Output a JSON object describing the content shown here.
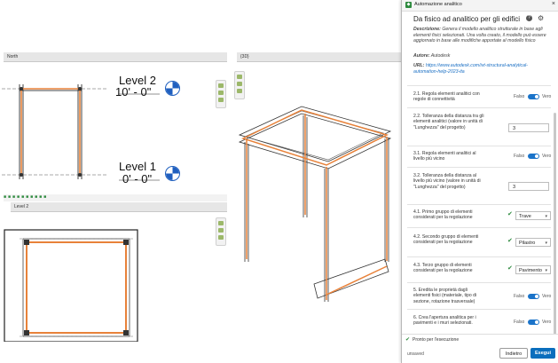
{
  "views": {
    "north": {
      "tab_label": "North",
      "close": "x"
    },
    "view3d": {
      "tab_label": "{3D}",
      "close": "x"
    },
    "level2": {
      "tab_label": "Level 2",
      "close": "x"
    }
  },
  "levels": [
    {
      "name": "Level 2",
      "elevation": "10' - 0\""
    },
    {
      "name": "Level 1",
      "elevation": "0' - 0\""
    }
  ],
  "panel": {
    "window_title": "Automazione analitico",
    "close": "×",
    "heading": "Da fisico ad analitico per gli edifici",
    "help": "?",
    "gear": "⚙",
    "description_label": "Descrizione:",
    "description": "Genera il modello analitico strutturale in base agli elementi fisici selezionati. Una volta creato, il modello può essere aggiornato in base alle modifiche apportate al modello fisico",
    "author_label": "Autore:",
    "author": "Autodesk",
    "url_label": "URL:",
    "url": "https://www.autodesk.com/ivt-structural-analytical-automation-help-2023-ita",
    "params": [
      {
        "label": "2.1. Regola elementi analitici con regole di connettività",
        "false_label": "Falso",
        "true_label": "Vero"
      },
      {
        "label": "2.2. Tolleranza della distanza tra gli elementi analitici (valore in unità di \"Lunghezza\" del progetto)",
        "value": "3"
      },
      {
        "label": "3.1. Regola elementi analitici al livello più vicino",
        "false_label": "Falso",
        "true_label": "Vero"
      },
      {
        "label": "3.2. Tolleranza della distanza al livello più vicino (valore in unità di \"Lunghezza\" del progetto)",
        "value": "3"
      },
      {
        "label": "4.1. Primo gruppo di elementi considerati per la regolazione",
        "selected": "Trave"
      },
      {
        "label": "4.2. Secondo gruppo di elementi considerati per la regolazione",
        "selected": "Pilastro"
      },
      {
        "label": "4.3. Terzo gruppo di elementi considerati per la regolazione",
        "selected": "Pavimento"
      },
      {
        "label": "5. Eredita le proprietà dagli elementi fisici (materiale, tipo di sezione, rotazione trasversale)",
        "false_label": "Falso",
        "true_label": "Vero"
      },
      {
        "label": "6. Crea l'apertura analitica per i pavimenti e i muri selezionati.",
        "false_label": "Falso",
        "true_label": "Vero"
      }
    ],
    "status": "Pronto per l'esecuzione",
    "unsaved": "unsaved",
    "back_button": "Indietro",
    "run_button": "Esegui"
  },
  "colors": {
    "analytical": "#e8823a",
    "accent": "#0a6ebd",
    "level_marker": "#1f5fbf"
  }
}
